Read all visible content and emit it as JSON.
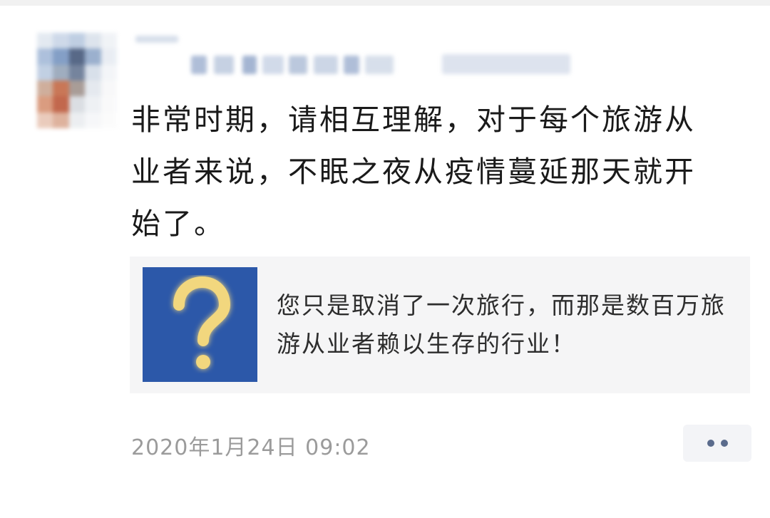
{
  "post": {
    "text": "非常时期，请相互理解，对于每个旅游从业者来说，不眠之夜从疫情蔓延那天就开始了。",
    "timestamp": "2020年1月24日 09:02"
  },
  "link_card": {
    "text": "您只是取消了一次旅行，而那是数百万旅游从业者赖以生存的行业！",
    "thumbnail_icon": "question-mark-icon"
  },
  "colors": {
    "thumbnail_bg": "#2c58a9",
    "question_mark": "#f2d77e",
    "timestamp": "#9b9b9b",
    "card_bg": "#f5f5f6",
    "more_dots": "#5a6b8c"
  }
}
